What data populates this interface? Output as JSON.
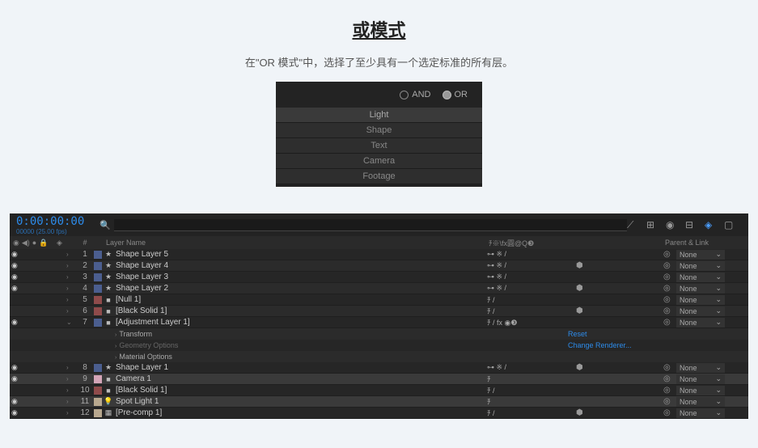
{
  "header": {
    "title": "或模式",
    "subtitle": "在\"OR 模式\"中，选择了至少具有一个选定标准的所有层。"
  },
  "modePanel": {
    "radio_and": "AND",
    "radio_or": "OR",
    "items": [
      "Light",
      "Shape",
      "Text",
      "Camera",
      "Footage"
    ]
  },
  "timeline": {
    "timecode": "0:00:00:00",
    "timecode_sub": "00000 (25.00 fps)",
    "columns": {
      "num_header": "#",
      "layer_name": "Layer Name",
      "modes": "ﾁ※\\fx圓@Q❸",
      "parent": "Parent & Link"
    },
    "switches_header": "◉◀)●🔒",
    "layers": [
      {
        "num": "1",
        "icon": "★",
        "name": "Shape Layer 5",
        "color": "c-blue",
        "eye": true,
        "modes": "⊶ ※ /",
        "cube": false,
        "parent": "None"
      },
      {
        "num": "2",
        "icon": "★",
        "name": "Shape Layer 4",
        "color": "c-blue",
        "eye": true,
        "modes": "⊶ ※ /",
        "cube": true,
        "parent": "None"
      },
      {
        "num": "3",
        "icon": "★",
        "name": "Shape Layer 3",
        "color": "c-blue",
        "eye": true,
        "modes": "⊶ ※ /",
        "cube": false,
        "parent": "None"
      },
      {
        "num": "4",
        "icon": "★",
        "name": "Shape Layer 2",
        "color": "c-blue",
        "eye": true,
        "modes": "⊶ ※ /",
        "cube": true,
        "parent": "None"
      },
      {
        "num": "5",
        "icon": "■",
        "name": "[Null 1]",
        "color": "c-red",
        "eye": false,
        "modes": "ﾁ /",
        "cube": false,
        "parent": "None"
      },
      {
        "num": "6",
        "icon": "■",
        "name": "[Black Solid 1]",
        "color": "c-red",
        "eye": false,
        "modes": "ﾁ /",
        "cube": true,
        "parent": "None"
      },
      {
        "num": "7",
        "icon": "■",
        "name": "[Adjustment Layer 1]",
        "color": "c-blue",
        "eye": true,
        "modes": "ﾁ / fx ◉❸",
        "cube": false,
        "parent": "None",
        "expanded": true
      }
    ],
    "props": [
      {
        "name": "Transform",
        "value": "Reset",
        "dim": false
      },
      {
        "name": "Geometry Options",
        "value": "Change Renderer...",
        "dim": true
      },
      {
        "name": "Material Options",
        "value": "",
        "dim": false
      }
    ],
    "layers2": [
      {
        "num": "8",
        "icon": "★",
        "name": "Shape Layer 1",
        "color": "c-blue",
        "eye": true,
        "modes": "⊶ ※ /",
        "cube": true,
        "parent": "None"
      },
      {
        "num": "9",
        "icon": "■",
        "name": "Camera 1",
        "color": "c-pink",
        "eye": true,
        "modes": "ﾁ",
        "cube": false,
        "parent": "None",
        "selected": true,
        "camera": true
      },
      {
        "num": "10",
        "icon": "■",
        "name": "[Black Solid 1]",
        "color": "c-red",
        "eye": false,
        "modes": "ﾁ /",
        "cube": false,
        "parent": "None"
      },
      {
        "num": "11",
        "icon": "💡",
        "name": "Spot Light 1",
        "color": "c-tan",
        "eye": true,
        "modes": "ﾁ",
        "cube": false,
        "parent": "None",
        "selected": true,
        "light": true
      },
      {
        "num": "12",
        "icon": "▦",
        "name": "[Pre-comp 1]",
        "color": "c-tan",
        "eye": true,
        "modes": "ﾁ /",
        "cube": true,
        "parent": "None"
      }
    ]
  }
}
